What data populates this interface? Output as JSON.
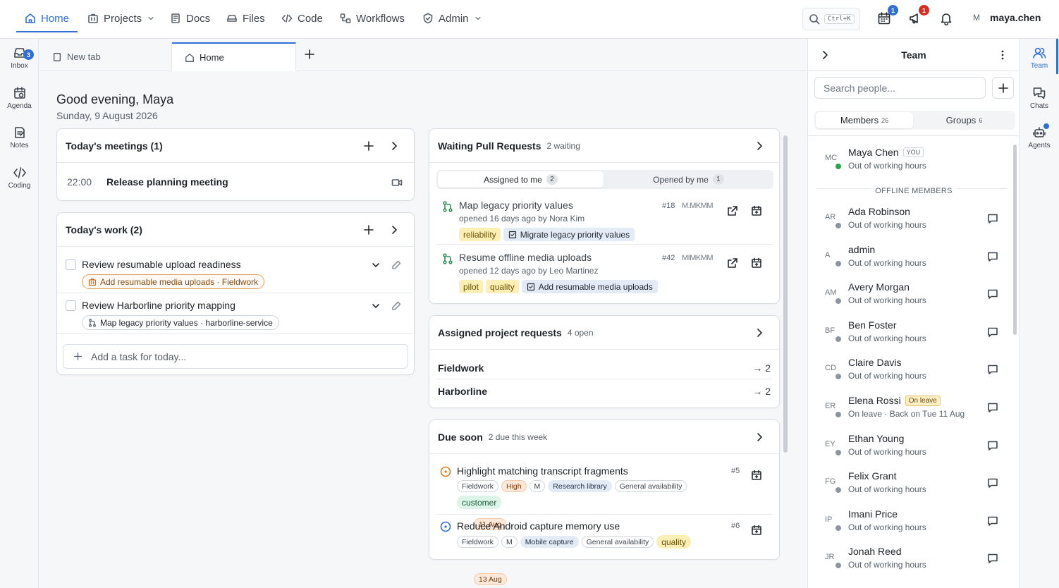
{
  "nav": {
    "items": [
      {
        "label": "Home",
        "icon": "home-icon"
      },
      {
        "label": "Projects",
        "icon": "projects-icon"
      },
      {
        "label": "Docs",
        "icon": "docs-icon"
      },
      {
        "label": "Files",
        "icon": "files-icon"
      },
      {
        "label": "Code",
        "icon": "code-icon"
      },
      {
        "label": "Workflows",
        "icon": "workflows-icon"
      },
      {
        "label": "Admin",
        "icon": "shield-icon"
      }
    ],
    "search_shortcut": "Ctrl+K",
    "calendar_badge": "1",
    "announce_badge": "1",
    "user_initial": "M",
    "username": "maya.chen",
    "accent": "#2f6fd6",
    "badge_red": "#d92d20"
  },
  "left_rail": [
    {
      "label": "Inbox",
      "badge": "3"
    },
    {
      "label": "Agenda"
    },
    {
      "label": "Notes"
    },
    {
      "label": "Coding"
    }
  ],
  "tabs": [
    {
      "label": "New tab"
    },
    {
      "label": "Home"
    }
  ],
  "greeting": "Good evening, Maya",
  "date": "Sunday, 9 August 2026",
  "meetings": {
    "title": "Today's meetings (1)",
    "items": [
      {
        "time": "22:00",
        "title": "Release planning meeting"
      }
    ]
  },
  "work": {
    "title": "Today's work (2)",
    "items": [
      {
        "title": "Review resumable upload readiness",
        "ref": "Add resumable media uploads · Fieldwork"
      },
      {
        "title": "Review Harborline priority mapping",
        "ref": "Map legacy priority values · harborline-service"
      }
    ],
    "add_placeholder": "Add a task for today..."
  },
  "prs": {
    "title": "Waiting Pull Requests",
    "sub": "2 waiting",
    "tab_assigned": "Assigned to me",
    "tab_assigned_count": "2",
    "tab_opened": "Opened by me",
    "tab_opened_count": "1",
    "items": [
      {
        "title": "Map legacy priority values",
        "meta": "opened 16 days ago by Nora Kim",
        "num": "#18",
        "avatars": "M.MKMM",
        "labels": [
          "reliability"
        ],
        "link": "Migrate legacy priority values"
      },
      {
        "title": "Resume offline media uploads",
        "meta": "opened 12 days ago by Leo Martinez",
        "num": "#42",
        "avatars": "MIMKMM",
        "labels": [
          "pilot",
          "quality"
        ],
        "link": "Add resumable media uploads"
      }
    ]
  },
  "requests": {
    "title": "Assigned project requests",
    "sub": "4 open",
    "items": [
      {
        "name": "Fieldwork",
        "count": "→ 2"
      },
      {
        "name": "Harborline",
        "count": "→ 2"
      }
    ]
  },
  "due": {
    "title": "Due soon",
    "sub": "2 due this week",
    "items": [
      {
        "title": "Highlight matching transcript fragments",
        "num": "#5",
        "chips": [
          "Fieldwork",
          "High",
          "M",
          "11 Aug",
          "Research library",
          "General availability"
        ],
        "extra": "customer"
      },
      {
        "title": "Reduce Android capture memory use",
        "num": "#6",
        "chips": [
          "Fieldwork",
          "M",
          "13 Aug",
          "Mobile capture",
          "General availability"
        ],
        "extra": "quality"
      }
    ]
  },
  "team": {
    "title": "Team",
    "search_placeholder": "Search people...",
    "tab_members": "Members",
    "members_count": "26",
    "tab_groups": "Groups",
    "groups_count": "6",
    "me": {
      "initials": "MC",
      "name": "Maya Chen",
      "you": "YOU",
      "status": "Out of working hours"
    },
    "offline_label": "OFFLINE MEMBERS",
    "people": [
      {
        "initials": "AR",
        "name": "Ada Robinson",
        "status": "Out of working hours"
      },
      {
        "initials": "A",
        "name": "admin",
        "status": "Out of working hours"
      },
      {
        "initials": "AM",
        "name": "Avery Morgan",
        "status": "Out of working hours"
      },
      {
        "initials": "BF",
        "name": "Ben Foster",
        "status": "Out of working hours"
      },
      {
        "initials": "CD",
        "name": "Claire Davis",
        "status": "Out of working hours"
      },
      {
        "initials": "ER",
        "name": "Elena Rossi",
        "status": "On leave · Back on Tue 11 Aug",
        "badge": "On leave"
      },
      {
        "initials": "EY",
        "name": "Ethan Young",
        "status": "Out of working hours"
      },
      {
        "initials": "FG",
        "name": "Felix Grant",
        "status": "Out of working hours"
      },
      {
        "initials": "IP",
        "name": "Imani Price",
        "status": "Out of working hours"
      },
      {
        "initials": "JR",
        "name": "Jonah Reed",
        "status": "Out of working hours"
      }
    ]
  },
  "right_rail": [
    {
      "label": "Team"
    },
    {
      "label": "Chats"
    },
    {
      "label": "Agents"
    }
  ]
}
